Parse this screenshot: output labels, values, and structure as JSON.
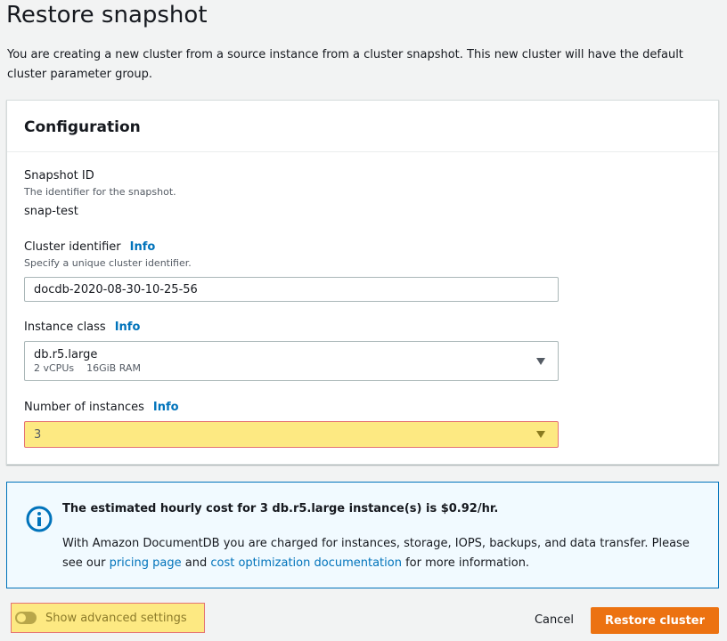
{
  "page": {
    "title": "Restore snapshot",
    "intro": "You are creating a new cluster from a source instance from a cluster snapshot. This new cluster will have the default cluster parameter group."
  },
  "configuration": {
    "heading": "Configuration",
    "snapshot_id": {
      "label": "Snapshot ID",
      "description": "The identifier for the snapshot.",
      "value": "snap-test"
    },
    "cluster_identifier": {
      "label": "Cluster identifier",
      "info": "Info",
      "description": "Specify a unique cluster identifier.",
      "value": "docdb-2020-08-30-10-25-56"
    },
    "instance_class": {
      "label": "Instance class",
      "info": "Info",
      "selected": "db.r5.large",
      "vcpus": "2 vCPUs",
      "ram": "16GiB RAM"
    },
    "number_of_instances": {
      "label": "Number of instances",
      "info": "Info",
      "selected": "3"
    }
  },
  "cost_alert": {
    "icon": "info-circle-icon",
    "title": "The estimated hourly cost for 3 db.r5.large instance(s) is $0.92/hr.",
    "body_1": "With Amazon DocumentDB you are charged for instances, storage, IOPS, backups, and data transfer. Please see our ",
    "link_pricing": "pricing page",
    "body_2": " and ",
    "link_cost": "cost optimization documentation",
    "body_3": " for more information."
  },
  "footer": {
    "advanced_toggle_label": "Show advanced settings",
    "cancel_label": "Cancel",
    "restore_label": "Restore cluster"
  },
  "colors": {
    "primary": "#ec7211",
    "link": "#0073bb",
    "highlight": "#fde982",
    "highlight_border": "#e57373"
  }
}
